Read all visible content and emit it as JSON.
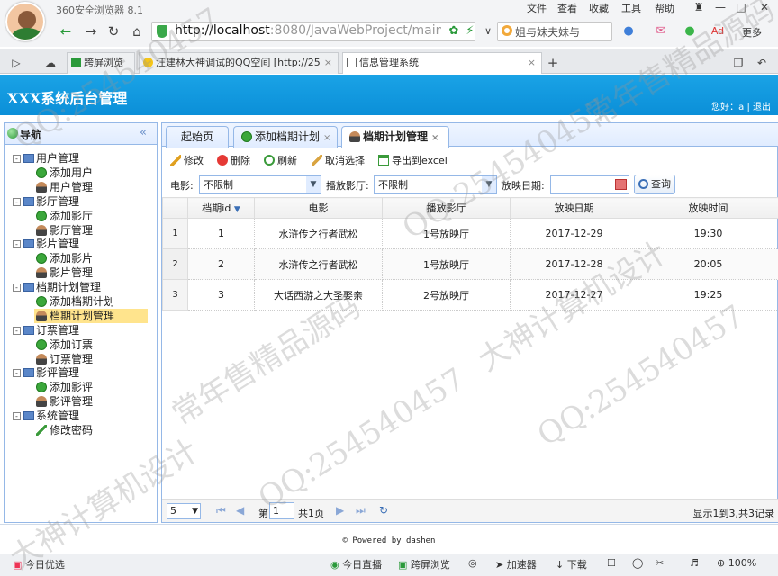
{
  "browser": {
    "title": "360安全浏览器 8.1",
    "menus": [
      "文件",
      "查看",
      "收藏",
      "工具",
      "帮助"
    ],
    "address_host": "http://localhost",
    "address_rest": ":8080/JavaWebProject/main.jsp",
    "search_text": "姐与妹夫妹与",
    "more_label": "更多",
    "tabs": [
      {
        "label": "跨屏浏览"
      },
      {
        "label": "汪建林大神调试的QQ空间 [http://25"
      },
      {
        "label": "信息管理系统"
      }
    ]
  },
  "app": {
    "title": "XXX系统后台管理",
    "user_greeting": "您好：a",
    "logout_label": "退出"
  },
  "sidebar": {
    "title": "导航",
    "groups": [
      {
        "label": "用户管理",
        "items": [
          {
            "label": "添加用户",
            "icon": "add-icon"
          },
          {
            "label": "用户管理",
            "icon": "user-icon"
          }
        ]
      },
      {
        "label": "影厅管理",
        "items": [
          {
            "label": "添加影厅",
            "icon": "add-icon"
          },
          {
            "label": "影厅管理",
            "icon": "user-icon"
          }
        ]
      },
      {
        "label": "影片管理",
        "items": [
          {
            "label": "添加影片",
            "icon": "add-icon"
          },
          {
            "label": "影片管理",
            "icon": "user-icon"
          }
        ]
      },
      {
        "label": "档期计划管理",
        "items": [
          {
            "label": "添加档期计划",
            "icon": "add-icon"
          },
          {
            "label": "档期计划管理",
            "icon": "user-icon",
            "selected": true
          }
        ]
      },
      {
        "label": "订票管理",
        "items": [
          {
            "label": "添加订票",
            "icon": "add-icon"
          },
          {
            "label": "订票管理",
            "icon": "user-icon"
          }
        ]
      },
      {
        "label": "影评管理",
        "items": [
          {
            "label": "添加影评",
            "icon": "add-icon"
          },
          {
            "label": "影评管理",
            "icon": "user-icon"
          }
        ]
      },
      {
        "label": "系统管理",
        "items": [
          {
            "label": "修改密码",
            "icon": "pencil-icon"
          }
        ]
      }
    ]
  },
  "main_tabs": [
    {
      "label": "起始页"
    },
    {
      "label": "添加档期计划"
    },
    {
      "label": "档期计划管理"
    }
  ],
  "toolbar": {
    "edit": "修改",
    "delete": "删除",
    "refresh": "刷新",
    "cancel_select": "取消选择",
    "export": "导出到excel"
  },
  "filters": {
    "movie_label": "电影:",
    "movie_value": "不限制",
    "hall_label": "播放影厅:",
    "hall_value": "不限制",
    "date_label": "放映日期:",
    "date_value": "",
    "query_label": "查询"
  },
  "grid": {
    "columns": [
      "档期id",
      "电影",
      "播放影厅",
      "放映日期",
      "放映时间"
    ],
    "rows": [
      {
        "rownum": "1",
        "id": "1",
        "movie": "水浒传之行者武松",
        "hall": "1号放映厅",
        "date": "2017-12-29",
        "time": "19:30"
      },
      {
        "rownum": "2",
        "id": "2",
        "movie": "水浒传之行者武松",
        "hall": "1号放映厅",
        "date": "2017-12-28",
        "time": "20:05"
      },
      {
        "rownum": "3",
        "id": "3",
        "movie": "大话西游之大圣娶亲",
        "hall": "2号放映厅",
        "date": "2017-12-27",
        "time": "19:25"
      }
    ]
  },
  "pager": {
    "page_size": "5",
    "page_prefix": "第",
    "page_number": "1",
    "page_total": "共1页",
    "info": "显示1到3,共3记录"
  },
  "footer": {
    "powered": "© Powered by dashen"
  },
  "statusbar": {
    "left": "今日优选",
    "items": [
      "今日直播",
      "跨屏浏览",
      "加速器",
      "下载"
    ],
    "zoom": "100%"
  },
  "watermarks": [
    "QQ:254540457",
    "大神计算机设计",
    "常年售精品源码"
  ]
}
